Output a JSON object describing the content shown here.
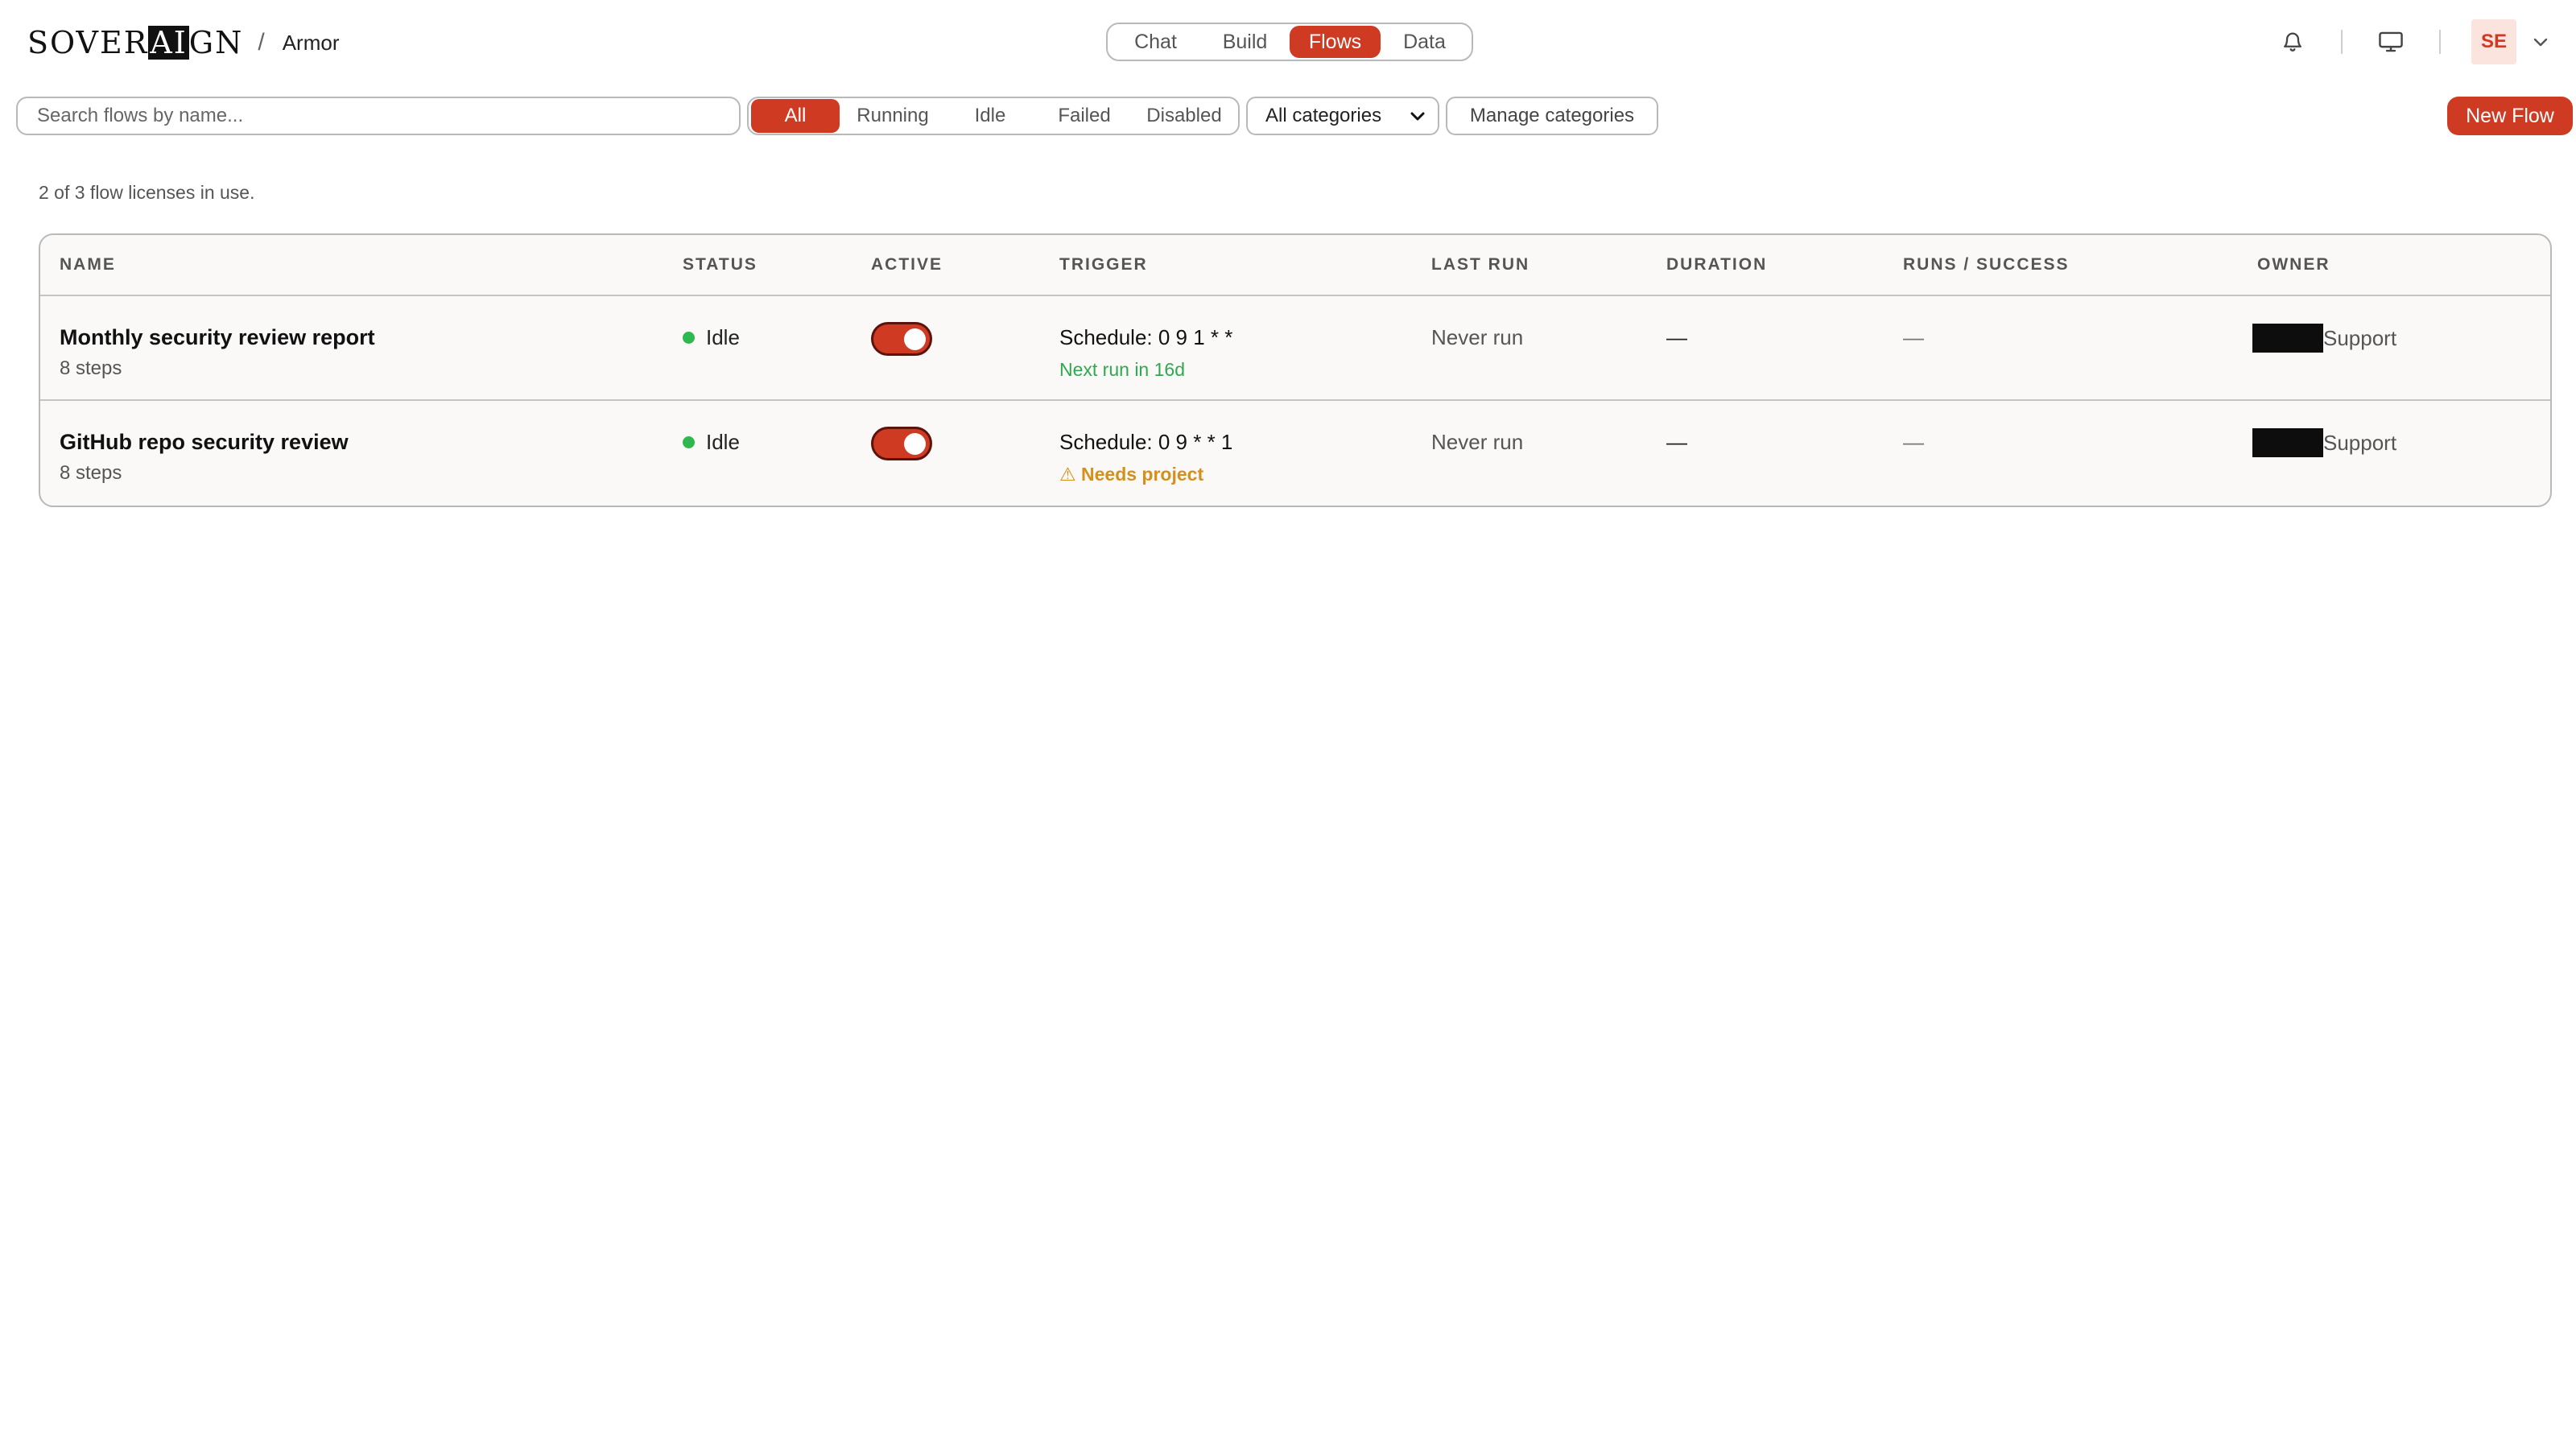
{
  "brand": {
    "logo_prefix": "SOVER",
    "logo_highlight": "AI",
    "logo_suffix": "GN",
    "separator": "/",
    "workspace": "Armor"
  },
  "nav": {
    "tabs": [
      {
        "label": "Chat"
      },
      {
        "label": "Build"
      },
      {
        "label": "Flows",
        "active": true
      },
      {
        "label": "Data"
      }
    ]
  },
  "header": {
    "avatar_initials": "SE",
    "icons": [
      "bell-icon",
      "monitor-icon",
      "chevron-down-icon"
    ]
  },
  "toolbar": {
    "search_placeholder": "Search flows by name...",
    "filters": [
      {
        "label": "All",
        "active": true
      },
      {
        "label": "Running"
      },
      {
        "label": "Idle"
      },
      {
        "label": "Failed"
      },
      {
        "label": "Disabled"
      }
    ],
    "category_select": "All categories",
    "manage_label": "Manage categories",
    "new_flow_label": "New Flow"
  },
  "license_note": "2 of 3 flow licenses in use.",
  "table": {
    "columns": [
      "NAME",
      "STATUS",
      "ACTIVE",
      "TRIGGER",
      "LAST RUN",
      "DURATION",
      "RUNS / SUCCESS",
      "OWNER"
    ],
    "rows": [
      {
        "name": "Monthly security review report",
        "steps": "8 steps",
        "status": "Idle",
        "active": true,
        "trigger": "Schedule: 0 9 1 * *",
        "trigger_note": "Next run in 16d",
        "last_run": "Never run",
        "duration": "—",
        "runs": "—",
        "owner": "Support"
      },
      {
        "name": "GitHub repo security review",
        "steps": "8 steps",
        "status": "Idle",
        "active": true,
        "trigger": "Schedule: 0 9 * * 1",
        "trigger_warning": "⚠ Needs project",
        "last_run": "Never run",
        "duration": "—",
        "runs": "—",
        "owner": "Support"
      }
    ]
  },
  "colors": {
    "accent": "#cf3a23",
    "success": "#2fb84f",
    "warning": "#d4901c"
  }
}
